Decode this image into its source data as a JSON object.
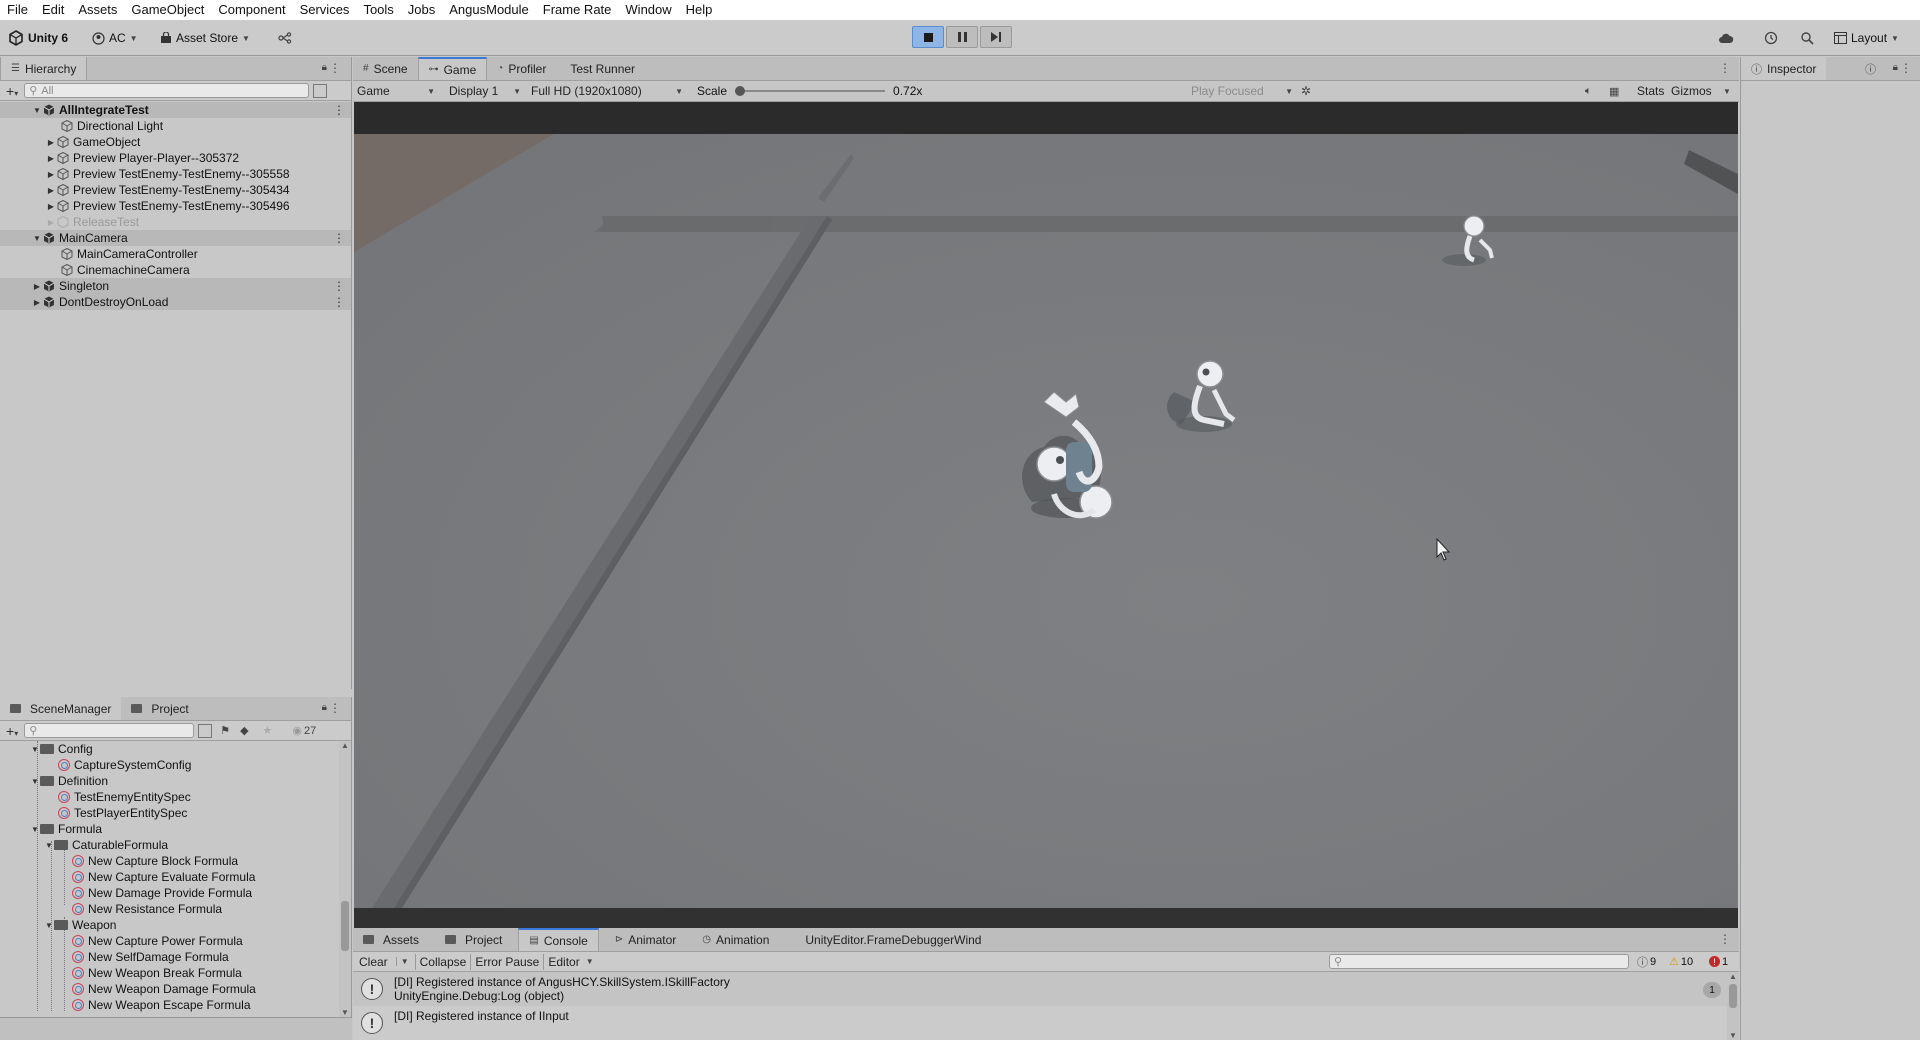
{
  "menubar": [
    "File",
    "Edit",
    "Assets",
    "GameObject",
    "Component",
    "Services",
    "Tools",
    "Jobs",
    "AngusModule",
    "Frame Rate",
    "Window",
    "Help"
  ],
  "toolbar": {
    "unity_label": "Unity 6",
    "account": "AC",
    "asset_store": "Asset Store",
    "layout": "Layout"
  },
  "hierarchy": {
    "tab": "Hierarchy",
    "search_placeholder": "All",
    "items": [
      {
        "label": "AllIntegrateTest",
        "bold": true
      },
      {
        "label": "Directional Light"
      },
      {
        "label": "GameObject"
      },
      {
        "label": "Preview Player-Player--305372"
      },
      {
        "label": "Preview TestEnemy-TestEnemy--305558"
      },
      {
        "label": "Preview TestEnemy-TestEnemy--305434"
      },
      {
        "label": "Preview TestEnemy-TestEnemy--305496"
      },
      {
        "label": "ReleaseTest"
      },
      {
        "label": "MainCamera"
      },
      {
        "label": "MainCameraController"
      },
      {
        "label": "CinemachineCamera"
      },
      {
        "label": "Singleton"
      },
      {
        "label": "DontDestroyOnLoad"
      }
    ]
  },
  "project_panel": {
    "tabs": [
      "SceneManager",
      "Project"
    ],
    "hidden_count": "27",
    "items": [
      {
        "label": "Config"
      },
      {
        "label": "CaptureSystemConfig"
      },
      {
        "label": "Definition"
      },
      {
        "label": "TestEnemyEntitySpec"
      },
      {
        "label": "TestPlayerEntitySpec"
      },
      {
        "label": "Formula"
      },
      {
        "label": "CaturableFormula"
      },
      {
        "label": "New Capture Block Formula"
      },
      {
        "label": "New Capture Evaluate Formula"
      },
      {
        "label": "New Damage Provide Formula"
      },
      {
        "label": "New Resistance Formula"
      },
      {
        "label": "Weapon"
      },
      {
        "label": "New Capture Power Formula"
      },
      {
        "label": "New SelfDamage Formula"
      },
      {
        "label": "New Weapon Break Formula"
      },
      {
        "label": "New Weapon Damage Formula"
      },
      {
        "label": "New Weapon Escape Formula"
      }
    ]
  },
  "center_tabs": [
    "Scene",
    "Game",
    "Profiler",
    "Test Runner"
  ],
  "game_bar": {
    "mode": "Game",
    "display": "Display 1",
    "resolution": "Full HD (1920x1080)",
    "scale_label": "Scale",
    "scale_value": "0.72x",
    "play_focused": "Play Focused",
    "stats": "Stats",
    "gizmos": "Gizmos"
  },
  "inspector": {
    "tab": "Inspector"
  },
  "bottom_tabs": [
    "Assets",
    "Project",
    "Console",
    "Animator",
    "Animation",
    "UnityEditor.FrameDebuggerWind"
  ],
  "console": {
    "clear": "Clear",
    "collapse": "Collapse",
    "error_pause": "Error Pause",
    "editor": "Editor",
    "log_count": "9",
    "warn_count": "10",
    "error_count": "1",
    "entries": [
      {
        "line1": "[DI] Registered instance of AngusHCY.SkillSystem.ISkillFactory",
        "line2": "UnityEngine.Debug:Log (object)",
        "count": "1"
      },
      {
        "line1": "[DI] Registered instance of IInput",
        "line2": "",
        "count": ""
      }
    ]
  },
  "colors": {
    "accent": "#3a79d9",
    "panel": "#c8c8c8",
    "ground": "#7b7d80"
  }
}
